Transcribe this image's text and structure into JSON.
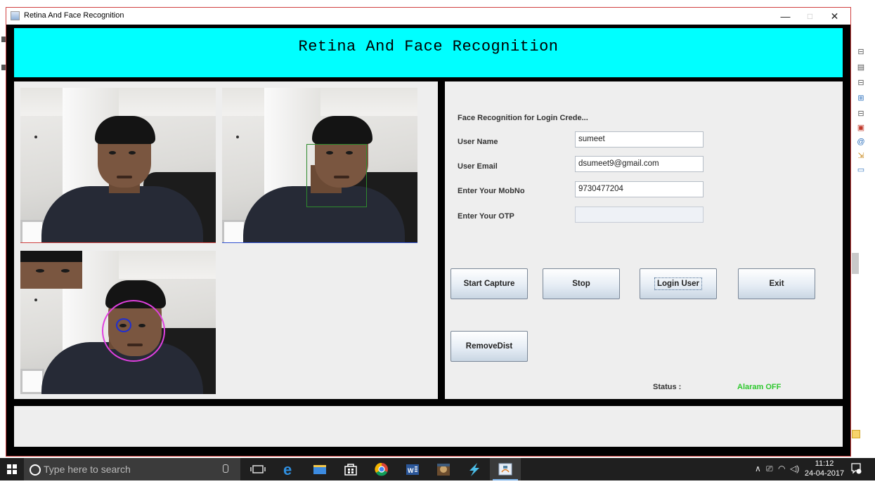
{
  "window": {
    "title": "Retina And Face Recognition",
    "controls": {
      "minimize": "—",
      "maximize": "□",
      "close": "✕"
    }
  },
  "header": {
    "title": "Retina And Face Recognition"
  },
  "form": {
    "heading": "Face Recognition for Login Crede...",
    "fields": [
      {
        "label": "User Name",
        "value": "sumeet"
      },
      {
        "label": "User Email",
        "value": "dsumeet9@gmail.com"
      },
      {
        "label": "Enter Your MobNo",
        "value": "9730477204"
      },
      {
        "label": "Enter Your OTP",
        "value": ""
      }
    ]
  },
  "buttons": {
    "start_capture": "Start Capture",
    "stop": "Stop",
    "login_user": "Login User",
    "exit": "Exit",
    "remove_dist": "RemoveDist"
  },
  "status": {
    "label": "Status :",
    "value": "Alaram OFF",
    "value_color": "#2ec82e"
  },
  "colors": {
    "header_bg": "#00ffff",
    "window_bg": "#000000",
    "panel_bg": "#eeeeee"
  },
  "taskbar": {
    "search_placeholder": "Type here to search",
    "apps": [
      "task-view-icon",
      "edge-icon",
      "file-explorer-icon",
      "store-icon",
      "chrome-icon",
      "word-icon",
      "photo-app-icon",
      "lightning-app-icon",
      "java-app-icon"
    ],
    "clock_time": "11:12",
    "clock_date": "24-04-2017"
  }
}
